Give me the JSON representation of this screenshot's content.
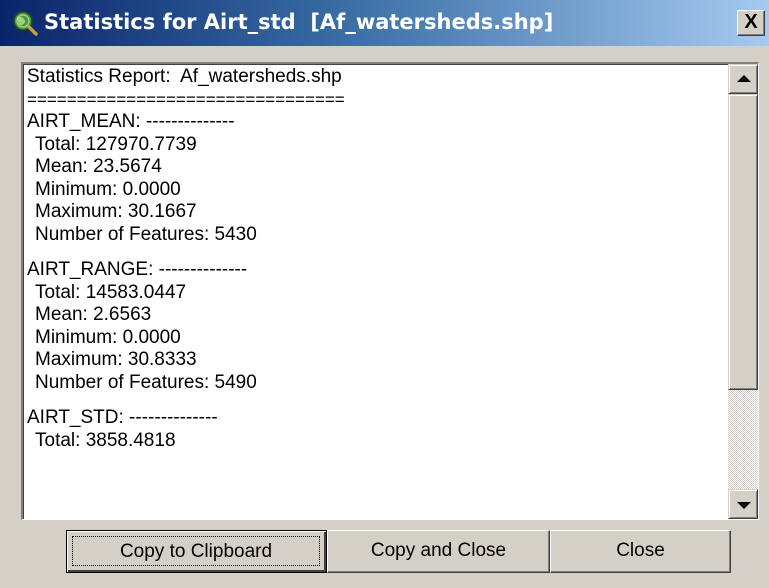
{
  "window": {
    "title": "Statistics for Airt_std  [Af_watersheds.shp]",
    "close_glyph": "X",
    "icon": "globe-magnifier-icon"
  },
  "report": {
    "header": "Statistics Report:  Af_watersheds.shp",
    "separator": "================================",
    "sections": [
      {
        "heading": "AIRT_MEAN: --------------",
        "total": "Total: 127970.7739",
        "mean": "Mean: 23.5674",
        "minimum": "Minimum: 0.0000",
        "maximum": "Maximum: 30.1667",
        "count": "Number of Features: 5430"
      },
      {
        "heading": "AIRT_RANGE: --------------",
        "total": "Total: 14583.0447",
        "mean": "Mean: 2.6563",
        "minimum": "Minimum: 0.0000",
        "maximum": "Maximum: 30.8333",
        "count": "Number of Features: 5490"
      },
      {
        "heading": "AIRT_STD: --------------",
        "total": "Total: 3858.4818"
      }
    ]
  },
  "buttons": {
    "copy_to_clipboard": "Copy to Clipboard",
    "copy_and_close": "Copy and Close",
    "close": "Close"
  },
  "colors": {
    "titlebar_start": "#0a246a",
    "titlebar_end": "#a6caf0",
    "dialog_face": "#d4d0c8"
  }
}
